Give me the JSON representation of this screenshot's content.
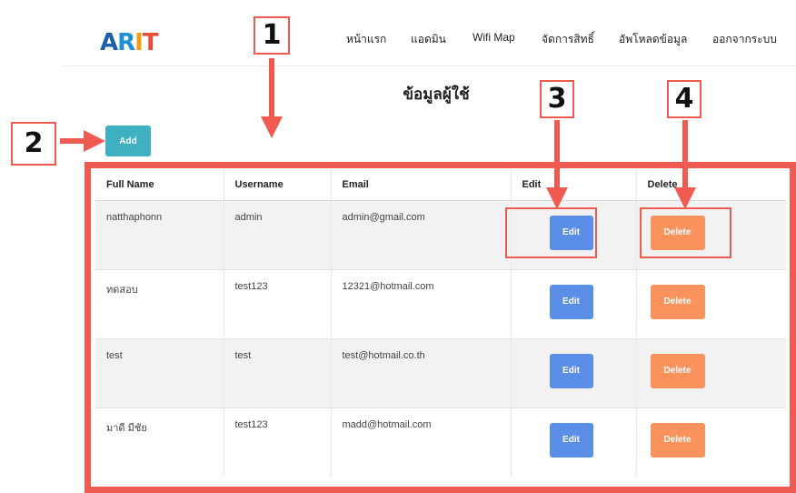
{
  "header": {
    "logo": {
      "a": "A",
      "r": "R",
      "i": "I",
      "t": "T"
    },
    "nav": [
      "หน้าแรก",
      "แอดมิน",
      "Wifi Map",
      "จัดการสิทธิ์",
      "อัพโหลดข้อมูล",
      "ออกจากระบบ"
    ]
  },
  "page_title": "ข้อมูลผู้ใช้",
  "add_label": "Add",
  "table": {
    "headers": [
      "Full Name",
      "Username",
      "Email",
      "Edit",
      "Delete"
    ],
    "rows": [
      {
        "full_name": "natthaphonn",
        "username": "admin",
        "email": "admin@gmail.com"
      },
      {
        "full_name": "ทดสอบ",
        "username": "test123",
        "email": "12321@hotmail.com"
      },
      {
        "full_name": "test",
        "username": "test",
        "email": "test@hotmail.co.th"
      },
      {
        "full_name": "มาดี มีชัย",
        "username": "test123",
        "email": "madd@hotmail.com"
      }
    ],
    "edit_label": "Edit",
    "delete_label": "Delete"
  },
  "annotations": [
    "1",
    "2",
    "3",
    "4"
  ],
  "colors": {
    "annotation": "#ef5b51",
    "add": "#3fb1c1",
    "edit": "#5b8ee6",
    "delete": "#f9935b"
  }
}
